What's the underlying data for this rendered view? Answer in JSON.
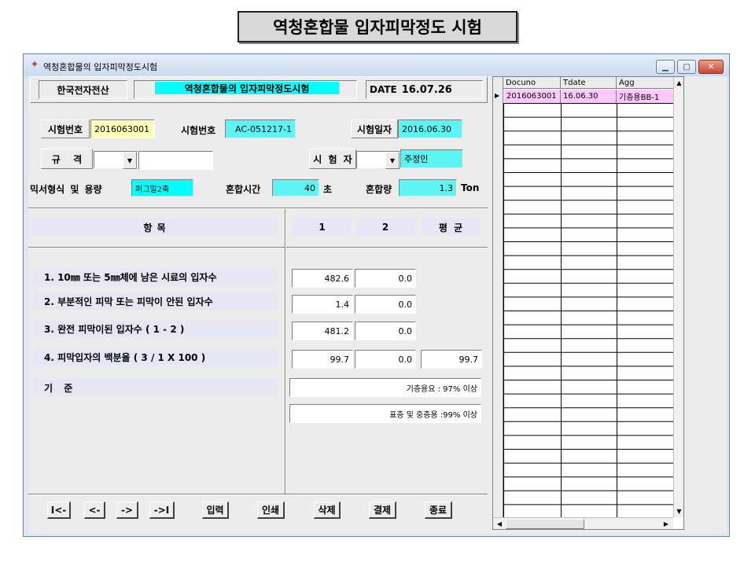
{
  "banner": "역청혼합물 입자피막정도 시험",
  "window": {
    "title": "역청혼합물의 입자피막정도시험",
    "minimize": "▁",
    "restore": "▢",
    "close": "✕"
  },
  "header": {
    "company": "한국전자전산",
    "form_title": "역청혼합물의 입자피막정도시험",
    "date_label": "DATE",
    "date_value": "16.07.26"
  },
  "form": {
    "test_no_label": "시험번호",
    "test_no_value": "2016063001",
    "test_no2_label": "시험번호",
    "test_no2_value": "AC-051217-1",
    "test_date_label": "시험일자",
    "test_date_value": "2016.06.30",
    "spec_label": "규  격",
    "spec_value": "",
    "spec_text": "",
    "tester_label": "시 험 자",
    "tester_value": "",
    "tester_name": "주정민",
    "mixer_label": "믹서형식 및 용량",
    "mixer_value": "퍼그밀2축",
    "mix_time_label": "혼합시간",
    "mix_time_value": "40",
    "mix_time_unit": "초",
    "mix_amount_label": "혼합량",
    "mix_amount_value": "1.3",
    "mix_amount_unit": "Ton"
  },
  "table": {
    "item_header": "항          목",
    "col1": "1",
    "col2": "2",
    "col_avg": "평  균",
    "rows": [
      {
        "label": "1. 10㎜ 또는 5㎜체에 남은 시료의 입자수",
        "v1": "482.6",
        "v2": "0.0"
      },
      {
        "label": "2. 부분적인 피막 또는 피막이 안된 입자수",
        "v1": "1.4",
        "v2": "0.0"
      },
      {
        "label": "3. 완전 피막이된 입자수 ( 1 - 2 )",
        "v1": "481.2",
        "v2": "0.0"
      },
      {
        "label": "4. 피막입자의 백분율  ( 3 / 1 X 100 )",
        "v1": "99.7",
        "v2": "0.0",
        "avg": "99.7"
      }
    ],
    "standard_label": "기       준",
    "standard_1": "기층용요 : 97% 이상",
    "standard_2": "표층 및 중층용 :99% 이상"
  },
  "buttons": {
    "first": "I<-",
    "prev": "<-",
    "next": "->",
    "last": "->I",
    "input": "입력",
    "print": "인쇄",
    "delete": "삭제",
    "approve": "결제",
    "exit": "종료"
  },
  "grid": {
    "columns": [
      "Docuno",
      "Tdate",
      "Agg"
    ],
    "rows": [
      {
        "docuno": "2016063001",
        "tdate": "16.06.30",
        "agg": "기층용BB-1"
      }
    ]
  },
  "colors": {
    "cyan": "#00ffff",
    "yellow": "#ffffb8",
    "row_highlight": "#ffc8ff"
  }
}
